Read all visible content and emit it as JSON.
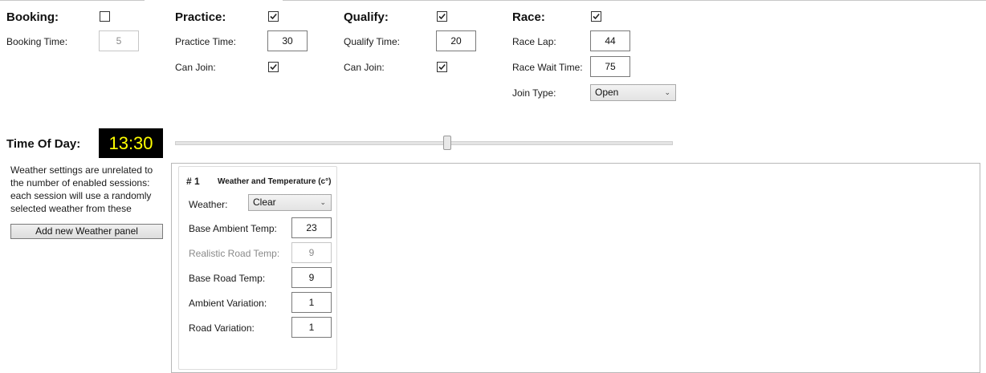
{
  "booking": {
    "title": "Booking:",
    "enabled": false,
    "time_label": "Booking Time:",
    "time_value": "5"
  },
  "practice": {
    "title": "Practice:",
    "enabled": true,
    "time_label": "Practice Time:",
    "time_value": "30",
    "can_join_label": "Can Join:",
    "can_join": true
  },
  "qualify": {
    "title": "Qualify:",
    "enabled": true,
    "time_label": "Qualify Time:",
    "time_value": "20",
    "can_join_label": "Can Join:",
    "can_join": true
  },
  "race": {
    "title": "Race:",
    "enabled": true,
    "lap_label": "Race Lap:",
    "lap_value": "44",
    "wait_label": "Race Wait Time:",
    "wait_value": "75",
    "join_type_label": "Join Type:",
    "join_type_value": "Open"
  },
  "time_of_day": {
    "label": "Time Of Day:",
    "value": "13:30",
    "slider_fraction": 0.55
  },
  "weather_note": {
    "line1": "Weather settings are unrelated to",
    "line2": "the number of enabled sessions:",
    "line3": "each session will use a randomly",
    "line4": "selected weather from these"
  },
  "add_weather_button": "Add new Weather panel",
  "weather_panel": {
    "number": "# 1",
    "title": "Weather and Temperature (c°)",
    "weather_label": "Weather:",
    "weather_value": "Clear",
    "base_ambient_label": "Base Ambient Temp:",
    "base_ambient_value": "23",
    "realistic_road_label": "Realistic Road Temp:",
    "realistic_road_value": "9",
    "base_road_label": "Base Road Temp:",
    "base_road_value": "9",
    "ambient_variation_label": "Ambient Variation:",
    "ambient_variation_value": "1",
    "road_variation_label": "Road Variation:",
    "road_variation_value": "1"
  },
  "colors": {
    "clock_bg": "#000000",
    "clock_fg": "#ffff00"
  },
  "icons": {
    "check": "check-icon",
    "dropdown": "chevron-down-icon"
  }
}
